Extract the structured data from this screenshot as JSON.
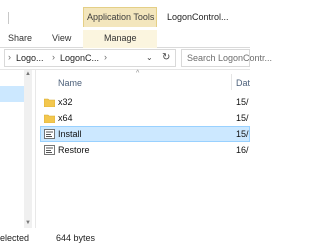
{
  "titlebar": {
    "contextual_tab": "Application Tools",
    "window_title": "LogonControl..."
  },
  "ribbon": {
    "tabs": [
      {
        "label": "Share"
      },
      {
        "label": "View"
      },
      {
        "label": "Manage"
      }
    ]
  },
  "address": {
    "crumbs": [
      "Logo...",
      "LogonC..."
    ],
    "search_placeholder": "Search LogonContr..."
  },
  "columns": {
    "name": "Name",
    "date": "Dat"
  },
  "files": [
    {
      "name": "x32",
      "date": "15/",
      "icon": "folder-icon"
    },
    {
      "name": "x64",
      "date": "15/",
      "icon": "folder-icon"
    },
    {
      "name": "Install",
      "date": "15/",
      "icon": "script-icon",
      "selected": true
    },
    {
      "name": "Restore",
      "date": "16/",
      "icon": "script-icon"
    }
  ],
  "status": {
    "selected_text": "elected",
    "size_text": "644 bytes"
  },
  "colors": {
    "contextual_tab_bg": "#f3e6bd",
    "selection_bg": "#cce8ff",
    "folder": "#f3c74e"
  }
}
